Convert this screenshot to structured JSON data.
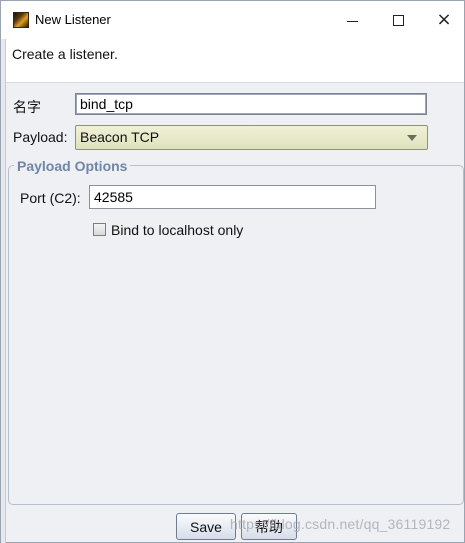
{
  "window": {
    "title": "New Listener",
    "icon": "cobalt-strike-app-icon",
    "controls": {
      "minimize": "minimize-icon",
      "maximize": "maximize-icon",
      "close": "×"
    }
  },
  "description": "Create a listener.",
  "form": {
    "name_label": "名字",
    "name_value": "bind_tcp",
    "payload_label": "Payload:",
    "payload_value": "Beacon TCP"
  },
  "payload_options": {
    "legend": "Payload Options",
    "port_label": "Port (C2):",
    "port_value": "42585",
    "bind_localhost_label": "Bind to localhost only",
    "bind_localhost_checked": false
  },
  "buttons": {
    "save": "Save",
    "help": "帮助"
  },
  "watermark": "https://blog.csdn.net/qq_36119192",
  "colors": {
    "legend": "#6f86a8",
    "select_bg": "#dfe2bd",
    "window_bg": "#eef0f4"
  }
}
